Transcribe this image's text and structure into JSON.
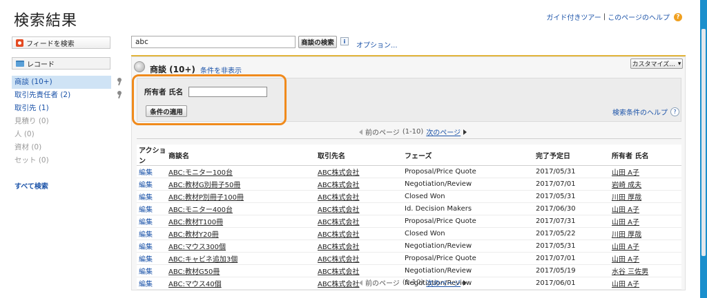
{
  "page_title": "検索結果",
  "top_help": {
    "tour": "ガイド付きツアー",
    "sep": "|",
    "help": "このページのヘルプ",
    "icon": "question-icon"
  },
  "sidebar": {
    "feed_search": "フィードを検索",
    "records_header": "レコード",
    "items": [
      {
        "label": "商談 (10+)",
        "selected": true,
        "pinned": true
      },
      {
        "label": "取引先責任者 (2)",
        "selected": false,
        "pinned": true
      },
      {
        "label": "取引先 (1)",
        "selected": false,
        "pinned": false
      },
      {
        "label": "見積り (0)",
        "selected": false,
        "pinned": false
      },
      {
        "label": "人 (0)",
        "selected": false,
        "pinned": false
      },
      {
        "label": "資材 (0)",
        "selected": false,
        "pinned": false
      },
      {
        "label": "セット (0)",
        "selected": false,
        "pinned": false
      }
    ],
    "all_search": "すべて検索"
  },
  "search": {
    "value": "abc",
    "button": "商談の検索",
    "info": "i",
    "options": "オプション..."
  },
  "panel": {
    "title": "商談 (10+)",
    "hide_conditions": "条件を非表示",
    "customize": "カスタマイズ...",
    "filter_label": "所有者 氏名",
    "filter_value": "",
    "apply_button": "条件の適用",
    "filter_help": "検索条件のヘルプ",
    "filter_help_icon": "?"
  },
  "pager": {
    "prev": "前のページ",
    "range": "(1-10)",
    "next": "次のページ"
  },
  "table": {
    "headers": [
      "アクション",
      "商談名",
      "取引先名",
      "フェーズ",
      "完了予定日",
      "所有者 氏名"
    ],
    "rows": [
      [
        "編集",
        "ABC:モニター100台",
        "ABC株式会社",
        "Proposal/Price Quote",
        "2017/05/31",
        "山田 A子"
      ],
      [
        "編集",
        "ABC:教材G別冊子50冊",
        "ABC株式会社",
        "Negotiation/Review",
        "2017/07/01",
        "岩崎 成夫"
      ],
      [
        "編集",
        "ABC:教材P別冊子100冊",
        "ABC株式会社",
        "Closed Won",
        "2017/05/31",
        "川田 厚哉"
      ],
      [
        "編集",
        "ABC:モニター400台",
        "ABC株式会社",
        "Id. Decision Makers",
        "2017/06/30",
        "山田 A子"
      ],
      [
        "編集",
        "ABC:教材T100冊",
        "ABC株式会社",
        "Proposal/Price Quote",
        "2017/07/31",
        "山田 A子"
      ],
      [
        "編集",
        "ABC:教材Y20冊",
        "ABC株式会社",
        "Closed Won",
        "2017/05/22",
        "川田 厚哉"
      ],
      [
        "編集",
        "ABC:マウス300個",
        "ABC株式会社",
        "Negotiation/Review",
        "2017/05/31",
        "山田 A子"
      ],
      [
        "編集",
        "ABC:キャビネ追加3個",
        "ABC株式会社",
        "Proposal/Price Quote",
        "2017/07/01",
        "山田 A子"
      ],
      [
        "編集",
        "ABC:教材G50冊",
        "ABC株式会社",
        "Negotiation/Review",
        "2017/05/19",
        "水谷 三佐男"
      ],
      [
        "編集",
        "ABC:マウス40個",
        "ABC株式会社",
        "Negotiation/Review",
        "2017/06/01",
        "山田 A子"
      ]
    ]
  },
  "colors": {
    "accent_orange": "#f08a1c",
    "link_blue": "#1a52a8",
    "panel_gold": "#e2b43a",
    "selected_bg": "#cfe3f5"
  }
}
